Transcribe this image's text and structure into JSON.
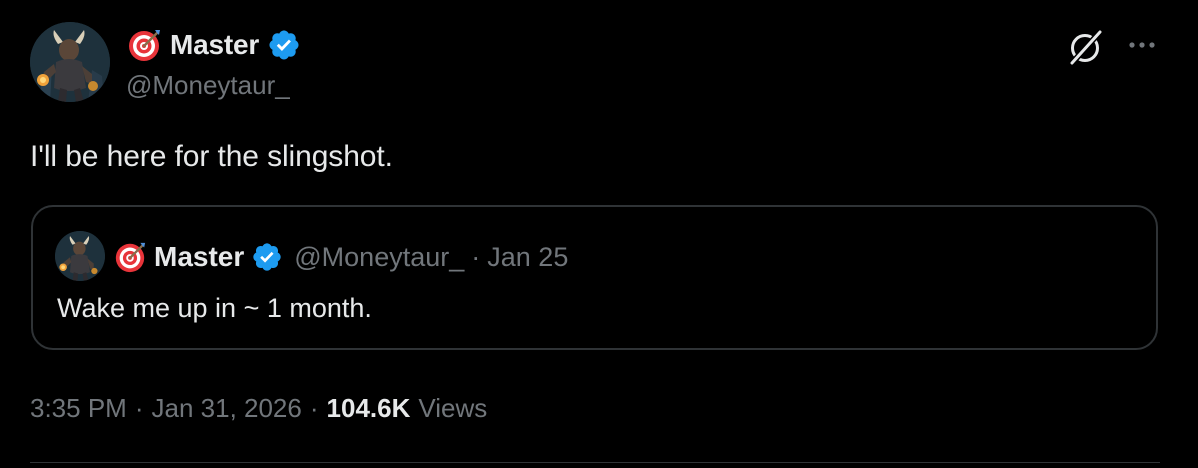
{
  "author": {
    "display_name": "Master",
    "handle": "@Moneytaur_",
    "emoji": "direct-hit-target-emoji",
    "verified": true
  },
  "tweet": {
    "text": "I'll be here for the slingshot."
  },
  "quoted_tweet": {
    "display_name": "Master",
    "handle": "@Moneytaur_",
    "separator": "·",
    "date": "Jan 25",
    "text": "Wake me up in ~ 1 month."
  },
  "meta": {
    "time": "3:35 PM",
    "separator1": "·",
    "date": "Jan 31, 2026",
    "separator2": "·",
    "views_count": "104.6K",
    "views_label": "Views"
  },
  "icons": {
    "grok": "grok-icon",
    "more": "more-horizontal-icon",
    "verified": "verified-badge-icon"
  },
  "colors": {
    "background": "#000000",
    "text_primary": "#e7e9ea",
    "text_secondary": "#71767b",
    "border": "#2f3336",
    "verified_blue": "#1d9bf0",
    "target_red": "#e8343a"
  }
}
